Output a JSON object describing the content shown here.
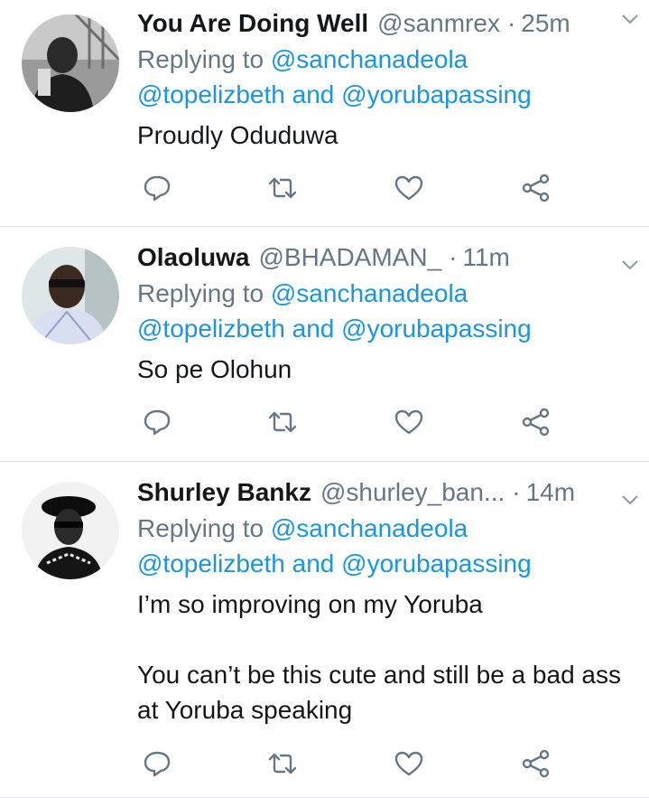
{
  "tweets": [
    {
      "name": "You Are Doing Well",
      "handle": "@sanmrex",
      "time": "25m",
      "replying_prefix": "Replying to ",
      "mention1": "@sanchanadeola",
      "mention2": "@topelizbeth",
      "and": " and ",
      "mention3": "@yorubapassing",
      "text": "Proudly Oduduwa"
    },
    {
      "name": "Olaoluwa",
      "handle": "@BHADAMAN_",
      "time": "11m",
      "replying_prefix": "Replying to ",
      "mention1": "@sanchanadeola",
      "mention2": "@topelizbeth",
      "and": " and ",
      "mention3": "@yorubapassing",
      "text": "So pe Olohun"
    },
    {
      "name": "Shurley Bankz",
      "handle": "@shurley_ban...",
      "time": "14m",
      "replying_prefix": "Replying to ",
      "mention1": "@sanchanadeola",
      "mention2": "@topelizbeth",
      "and": " and ",
      "mention3": "@yorubapassing",
      "text": "I’m so improving on my Yoruba\n\nYou can’t be this cute and still be a bad ass at Yoruba speaking"
    }
  ],
  "dot": "·",
  "colors": {
    "link": "#1b95e0",
    "muted": "#657786",
    "text": "#14171a",
    "divider": "#dfe3e8"
  },
  "icons": [
    "chevron-down-icon",
    "reply-icon",
    "retweet-icon",
    "like-icon",
    "share-icon"
  ]
}
